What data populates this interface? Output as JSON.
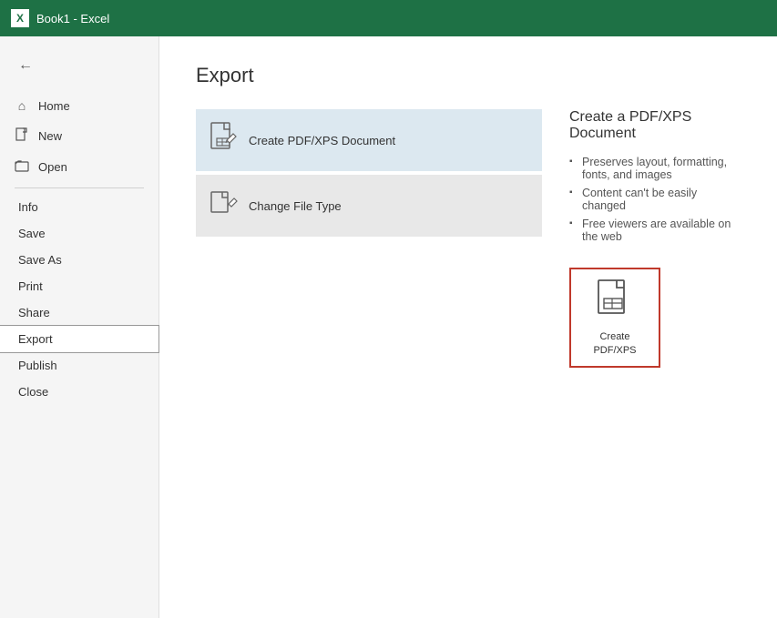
{
  "titleBar": {
    "iconText": "X",
    "title": "Book1  -  Excel"
  },
  "sidebar": {
    "backArrow": "←",
    "navItems": [
      {
        "id": "home",
        "icon": "⌂",
        "label": "Home"
      },
      {
        "id": "new",
        "icon": "□",
        "label": "New"
      },
      {
        "id": "open",
        "icon": "📁",
        "label": "Open"
      }
    ],
    "menuItems": [
      {
        "id": "info",
        "label": "Info"
      },
      {
        "id": "save",
        "label": "Save"
      },
      {
        "id": "save-as",
        "label": "Save As"
      },
      {
        "id": "print",
        "label": "Print"
      },
      {
        "id": "share",
        "label": "Share"
      },
      {
        "id": "export",
        "label": "Export",
        "active": true
      },
      {
        "id": "publish",
        "label": "Publish"
      },
      {
        "id": "close",
        "label": "Close"
      }
    ]
  },
  "content": {
    "title": "Export",
    "options": [
      {
        "id": "create-pdf",
        "label": "Create PDF/XPS Document",
        "selected": true
      },
      {
        "id": "change-file-type",
        "label": "Change File Type",
        "selected": false
      }
    ],
    "infoPanel": {
      "title": "Create a PDF/XPS Document",
      "bullets": [
        "Preserves layout, formatting, fonts, and images",
        "Content can't be easily changed",
        "Free viewers are available on the web"
      ],
      "card": {
        "label": "Create\nPDF/XPS"
      }
    }
  }
}
